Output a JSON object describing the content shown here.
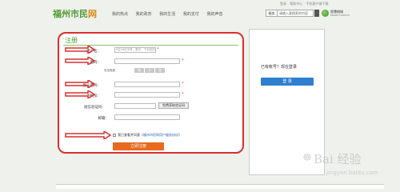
{
  "toplinks": [
    "登录",
    "帮助中心",
    "手机客户端下载"
  ],
  "header": {
    "logo_main": "福州市民",
    "logo_suffix": "网",
    "nav": [
      "我的热点",
      "我的政务",
      "我的生活",
      "我的支付",
      "我的声音"
    ],
    "search_select": "服务",
    "search_placeholder": "请输入要搜索的内容",
    "brand_name": "智慧榕城",
    "brand_sub": "SMART FUZHOU"
  },
  "form": {
    "title": "注册",
    "username_label": "用户名：",
    "username_placeholder": "6至16位字母、数字、下划线的组合",
    "password_label": "密码：",
    "strength_label": "安全程度",
    "strength_levels": [
      "弱",
      "中",
      "强"
    ],
    "confirm_label": "确认密码：",
    "phone_label": "手机号：",
    "code_label": "短信验证码：",
    "get_code_button": "免费获取验证码",
    "email_label": "邮箱：",
    "agree_text": "我已查看并同意",
    "agree_link": "《福州市民网用户服务协议》",
    "submit_button": "立即注册",
    "required_mark": "*"
  },
  "side": {
    "prompt": "已有帐号？现在登录",
    "login_button": "登 录"
  },
  "watermark": {
    "main": "Bai 经验",
    "sub": "jingyan.baidu.com",
    "paw": "☸"
  },
  "colors": {
    "accent_green": "#4f9a2f",
    "orange": "#e76a1e",
    "blue": "#2f7fd0",
    "highlight_red": "#d83030"
  }
}
